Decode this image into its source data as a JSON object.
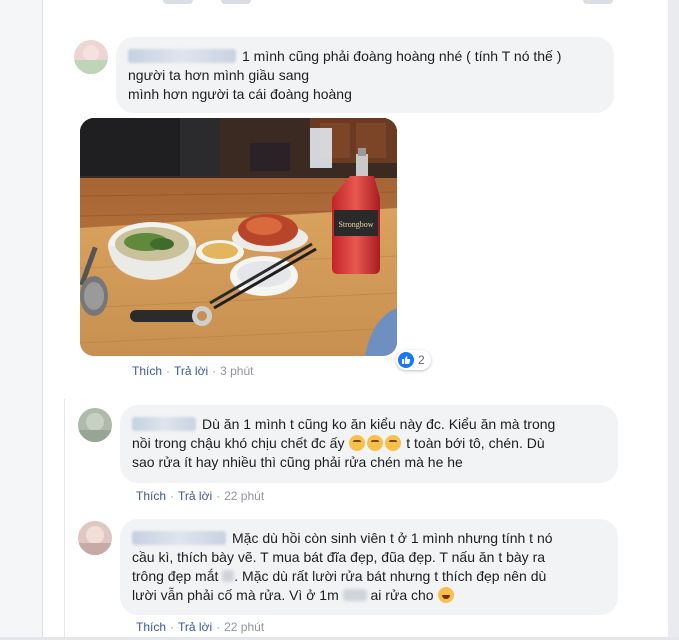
{
  "comments": [
    {
      "lines": [
        "1 mình cũng phải đoàng hoàng nhé ( tính T nó thế )",
        "người ta hơn mình giầu sang",
        "mình hơn người ta cái đoàng hoàng"
      ],
      "like_label": "Thích",
      "reply_label": "Trả lời",
      "time": "3 phút",
      "reaction_count": "2",
      "reaction_icon": "like-icon",
      "photo": {
        "bottle_label": "Strongbow"
      }
    },
    {
      "line1": "Dù ăn 1 mình t cũng ko ăn kiểu này đc. Kiểu ăn mà trong",
      "line2a": "nồi trong chậu khó chịu chết đc ấy",
      "line2b": "t toàn bới tô, chén. Dù",
      "line3": "sao rửa ít hay nhiều thì cũng phải rửa chén mà he he",
      "emoji": "thinking-face-icon",
      "like_label": "Thích",
      "reply_label": "Trả lời",
      "time": "22 phút"
    },
    {
      "line1": "Mặc dù hồi còn sinh viên t ở 1 mình nhưng tính t nó",
      "line2": "cầu kì, thích bày vẽ. T mua bát đĩa đẹp, đũa đẹp. T nấu ăn t bày ra",
      "line3": "trông đẹp mắt",
      "line3b": ". Mặc dù rất lười rửa bát nhưng t thích đẹp nên dù",
      "line4a": "lười vẫn phải cố mà rửa. Vì ở 1m",
      "line4b": "ai rửa cho",
      "emoji": "laughing-face-icon",
      "like_label": "Thích",
      "reply_label": "Trả lời",
      "time": "22 phút"
    }
  ],
  "colors": {
    "link": "#385898",
    "bubble": "#f2f3f5",
    "text": "#1c1e21",
    "meta": "#90949c",
    "like_blue": "#1877f2"
  }
}
